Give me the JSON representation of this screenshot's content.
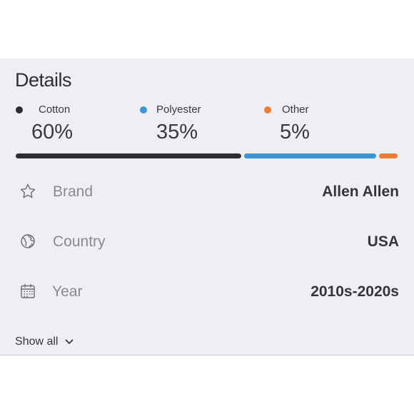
{
  "details": {
    "title": "Details",
    "composition": [
      {
        "name": "Cotton",
        "percent_label": "60%",
        "percent": 60,
        "color": "#2e2e31"
      },
      {
        "name": "Polyester",
        "percent_label": "35%",
        "percent": 35,
        "color": "#3b96d6"
      },
      {
        "name": "Other",
        "percent_label": "5%",
        "percent": 5,
        "color": "#ef7c35"
      }
    ],
    "rows": [
      {
        "label": "Brand",
        "value": "Allen Allen",
        "icon": "star-icon"
      },
      {
        "label": "Country",
        "value": "USA",
        "icon": "globe-icon"
      },
      {
        "label": "Year",
        "value": "2010s-2020s",
        "icon": "calendar-icon"
      }
    ],
    "show_all_label": "Show all"
  }
}
